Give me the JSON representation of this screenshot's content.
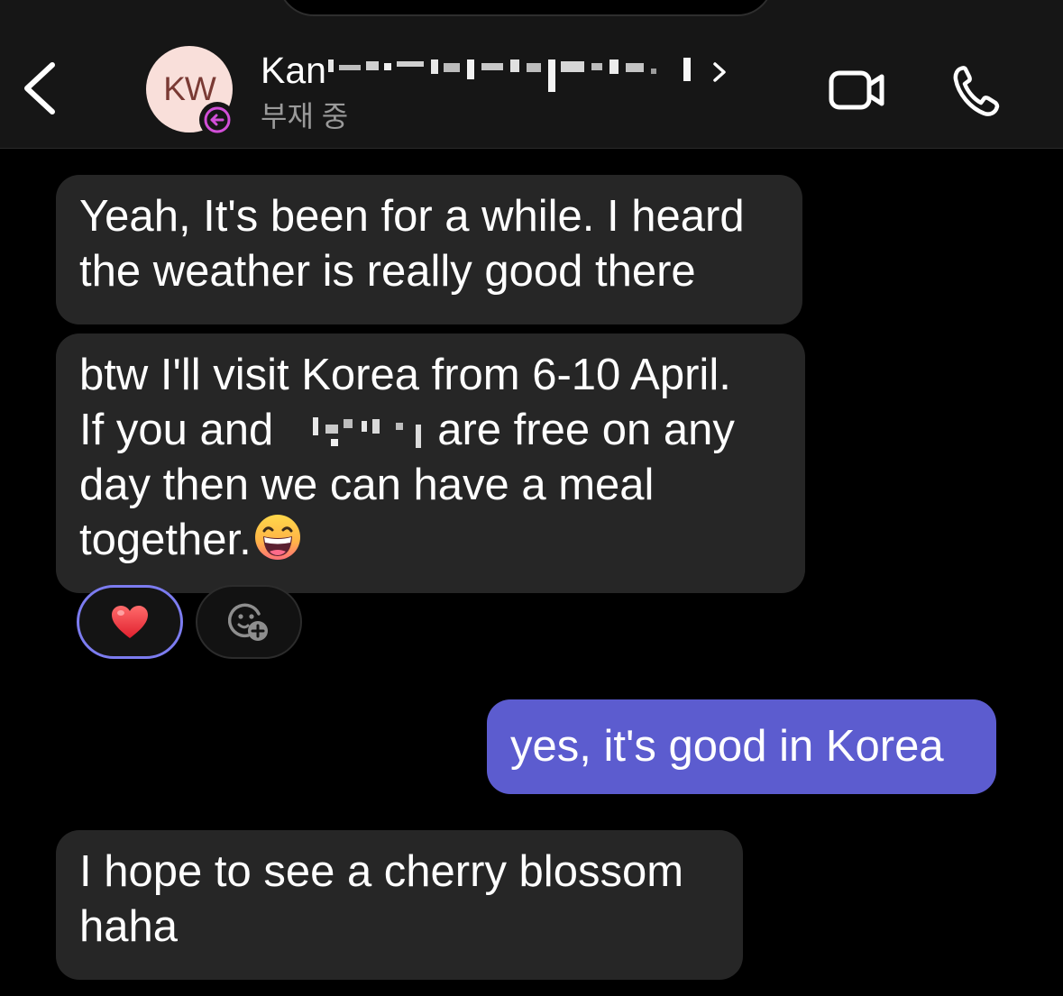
{
  "header": {
    "back_icon": "chevron-left-icon",
    "avatar_initials": "KW",
    "status_badge_icon": "arrow-left-circle-icon",
    "contact_name": "Kan",
    "contact_status": "부재 중",
    "name_chevron_icon": "chevron-right-icon",
    "video_call_icon": "video-camera-icon",
    "voice_call_icon": "phone-icon"
  },
  "messages": [
    {
      "direction": "incoming",
      "lines": [
        "Yeah, It's been for a while. I heard",
        "the weather is really good there"
      ]
    },
    {
      "direction": "incoming",
      "lines": [
        "btw I'll visit Korea from 6-10 April.",
        "If you and",
        "are free on any",
        "day then we can have a meal",
        "together."
      ],
      "emoji": "grinning-squinting-face",
      "reactions": [
        {
          "icon": "heart-icon",
          "selected": true
        },
        {
          "icon": "add-reaction-icon",
          "selected": false
        }
      ]
    },
    {
      "direction": "outgoing",
      "lines": [
        "yes, it's good in Korea"
      ]
    },
    {
      "direction": "incoming",
      "lines": [
        "I hope to see a cherry blossom",
        "haha"
      ]
    }
  ],
  "colors": {
    "background": "#000000",
    "header_background": "#161616",
    "incoming_bubble": "#262626",
    "outgoing_bubble": "#5c5ccf",
    "reaction_selected_border": "#7c7cf0",
    "status_text": "#9a9a9a",
    "avatar_background": "#f9dfda",
    "badge_accent": "#d24fd8"
  }
}
